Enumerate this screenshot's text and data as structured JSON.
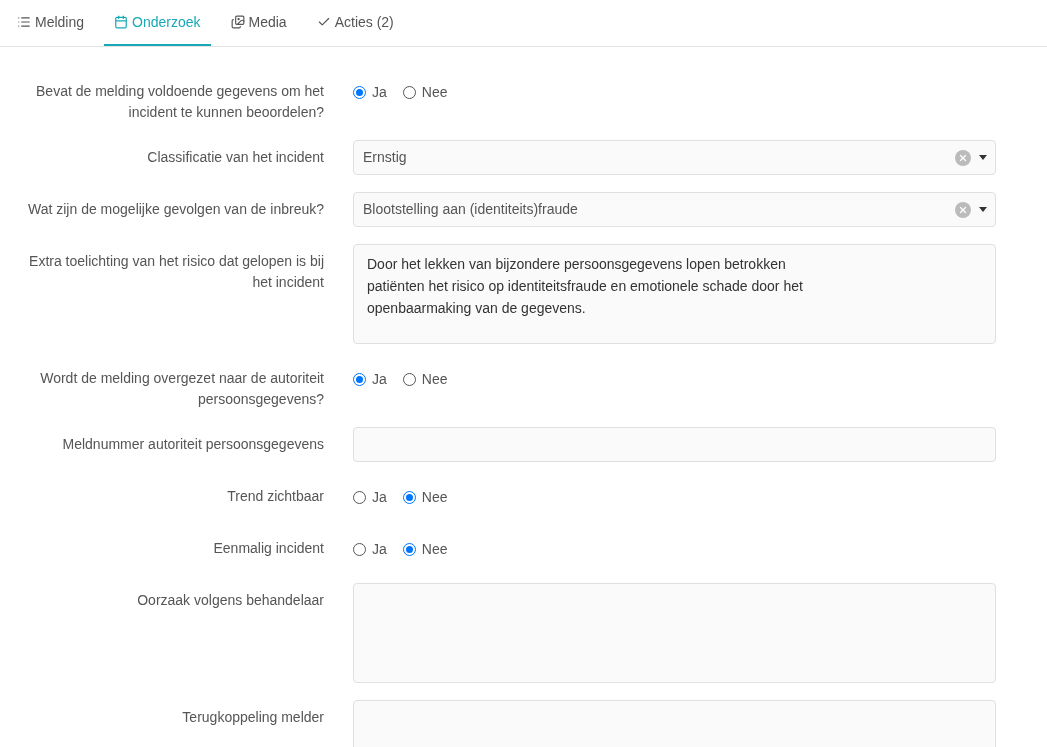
{
  "tabs": [
    {
      "label": "Melding",
      "kind": "list",
      "selected": false
    },
    {
      "label": "Onderzoek",
      "kind": "calendar",
      "selected": true
    },
    {
      "label": "Media",
      "kind": "images",
      "selected": false
    },
    {
      "label": "Acties (2)",
      "kind": "check",
      "selected": false
    }
  ],
  "form": [
    {
      "kind": "radio",
      "label": "Bevat de melding voldoende gegevens om het incident te kunnen beoordelen?",
      "options": [
        {
          "label": "Ja",
          "selected": true
        },
        {
          "label": "Nee",
          "selected": false
        }
      ]
    },
    {
      "kind": "select",
      "label": "Classificatie van het incident",
      "value": "Ernstig"
    },
    {
      "kind": "select",
      "label": "Wat zijn de mogelijke gevolgen van de inbreuk?",
      "value": "Blootstelling aan (identiteits)fraude"
    },
    {
      "kind": "textarea",
      "label": "Extra toelichting van het risico dat gelopen is bij het incident",
      "value": "Door het lekken van bijzondere persoonsgegevens lopen betrokken\npatiënten het risico op identiteitsfraude en emotionele schade door het\nopenbaarmaking van de gegevens."
    },
    {
      "kind": "radio",
      "label": "Wordt de melding overgezet naar de autoriteit persoonsgegevens?",
      "options": [
        {
          "label": "Ja",
          "selected": true
        },
        {
          "label": "Nee",
          "selected": false
        }
      ]
    },
    {
      "kind": "input",
      "label": "Meldnummer autoriteit persoonsgegevens"
    },
    {
      "kind": "radio",
      "label": "Trend zichtbaar",
      "options": [
        {
          "label": "Ja",
          "selected": false
        },
        {
          "label": "Nee",
          "selected": true
        }
      ]
    },
    {
      "kind": "radio",
      "label": "Eenmalig incident",
      "options": [
        {
          "label": "Ja",
          "selected": false
        },
        {
          "label": "Nee",
          "selected": true
        }
      ]
    },
    {
      "kind": "textarea",
      "label": "Oorzaak volgens behandelaar"
    },
    {
      "kind": "textarea",
      "label": "Terugkoppeling melder"
    }
  ]
}
